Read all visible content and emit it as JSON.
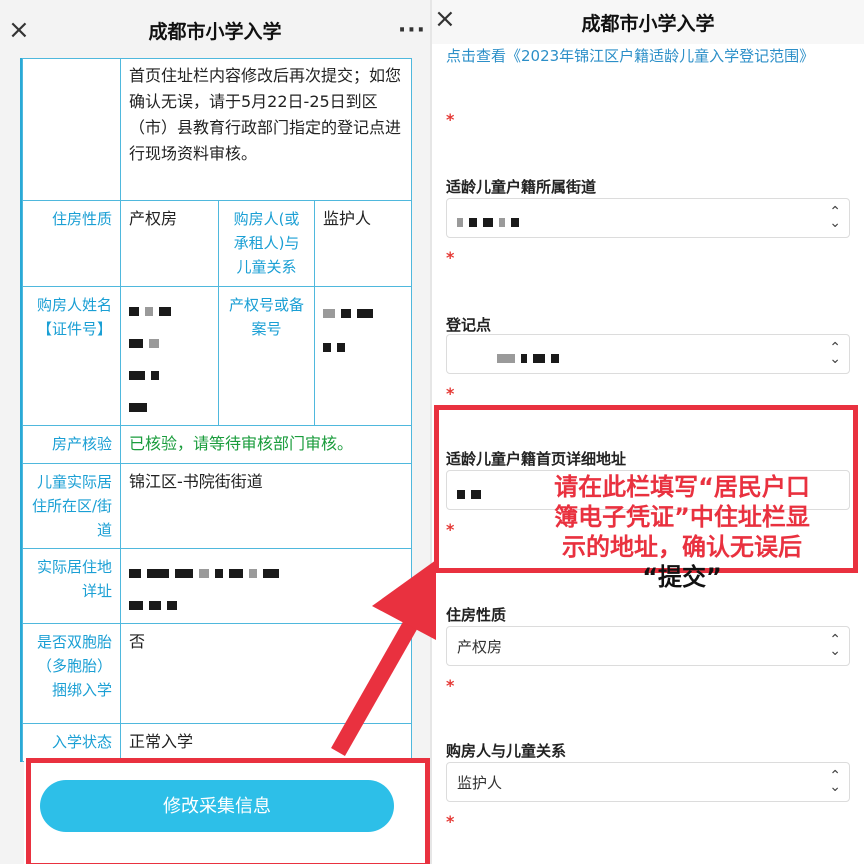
{
  "left": {
    "title": "成都市小学入学",
    "close_glyph": "×",
    "more_glyph": "···",
    "notice_text": "首页住址栏内容修改后再次提交；如您确认无误，请于5月22日-25日到区（市）县教育行政部门指定的登记点进行现场资料审核。",
    "rows": {
      "housing_type_label": "住房性质",
      "housing_type_value": "产权房",
      "buyer_relation_label": "购房人(或承租人)与儿童关系",
      "buyer_relation_value": "监护人",
      "buyer_name_label": "购房人姓名【证件号】",
      "property_no_label": "产权号或备案号",
      "verify_label": "房产核验",
      "verify_value": "已核验，请等待审核部门审核。",
      "residence_district_label": "儿童实际居住所在区/街道",
      "residence_district_value": "锦江区-书院街街道",
      "residence_address_label": "实际居住地详址",
      "twins_label": "是否双胞胎（多胞胎）捆绑入学",
      "twins_value": "否",
      "status_label": "入学状态",
      "status_value": "正常入学"
    },
    "edit_button": "修改采集信息"
  },
  "right": {
    "title": "成都市小学入学",
    "close_glyph": "×",
    "link_text": "点击查看《2023年锦江区户籍适龄儿童入学登记范围》",
    "required_mark": "*",
    "fields": {
      "street_label": "适龄儿童户籍所属街道",
      "registration_point_label": "登记点",
      "address_label": "适龄儿童户籍首页详细地址",
      "housing_type_label": "住房性质",
      "housing_type_value": "产权房",
      "relation_label": "购房人与儿童关系",
      "relation_value": "监护人"
    },
    "chevron_glyph": "⌃⌄",
    "annotation": {
      "line1": "请在此栏填写“居民户口",
      "line2": "簿电子凭证”中住址栏显",
      "line3": "示的地址，确认无误后",
      "line4": "“提交”"
    }
  },
  "colors": {
    "accent_blue": "#2dbfe8",
    "link_blue": "#2c8fc8",
    "highlight_red": "#e9313f",
    "verified_green": "#1a9c3c"
  }
}
